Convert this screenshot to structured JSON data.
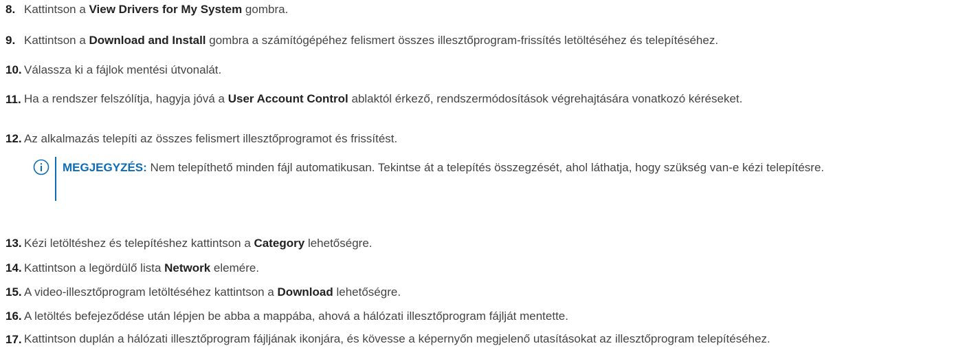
{
  "steps": [
    {
      "num": "8.",
      "pre": "Kattintson a ",
      "bold": "View Drivers for My System",
      "post": " gombra."
    },
    {
      "num": "9.",
      "pre": "Kattintson a ",
      "bold": "Download and Install",
      "post": " gombra a számítógépéhez felismert összes illesztőprogram-frissítés letöltéséhez és telepítéséhez."
    },
    {
      "num": "10.",
      "pre": "Válassza ki a fájlok mentési útvonalát.",
      "bold": "",
      "post": ""
    },
    {
      "num": "11.",
      "pre": "Ha a rendszer felszólítja, hagyja jóvá a ",
      "bold": "User Account Control",
      "post": " ablaktól érkező, rendszermódosítások végrehajtására vonatkozó kéréseket."
    },
    {
      "num": "12.",
      "pre": "Az alkalmazás telepíti az összes felismert illesztőprogramot és frissítést.",
      "bold": "",
      "post": ""
    },
    {
      "num": "13.",
      "pre": "Kézi letöltéshez és telepítéshez kattintson a ",
      "bold": "Category",
      "post": " lehetőségre."
    },
    {
      "num": "14.",
      "pre": "Kattintson a legördülő lista ",
      "bold": "Network",
      "post": " elemére."
    },
    {
      "num": "15.",
      "pre": "A video-illesztőprogram letöltéséhez kattintson a ",
      "bold": "Download",
      "post": " lehetőségre."
    },
    {
      "num": "16.",
      "pre": "A letöltés befejeződése után lépjen be abba a mappába, ahová a hálózati illesztőprogram fájlját mentette.",
      "bold": "",
      "post": ""
    },
    {
      "num": "17.",
      "pre": "Kattintson duplán a hálózati illesztőprogram fájljának ikonjára, és kövesse a képernyőn megjelenő utasításokat az illesztőprogram telepítéséhez.",
      "bold": "",
      "post": ""
    }
  ],
  "note": {
    "icon": "info-icon",
    "label": "MEGJEGYZÉS:",
    "text": " Nem telepíthető minden fájl automatikusan. Tekintse át a telepítés összegzését, ahol láthatja, hogy szükség van-e kézi telepítésre.",
    "accent_color": "#0e6bb5"
  }
}
